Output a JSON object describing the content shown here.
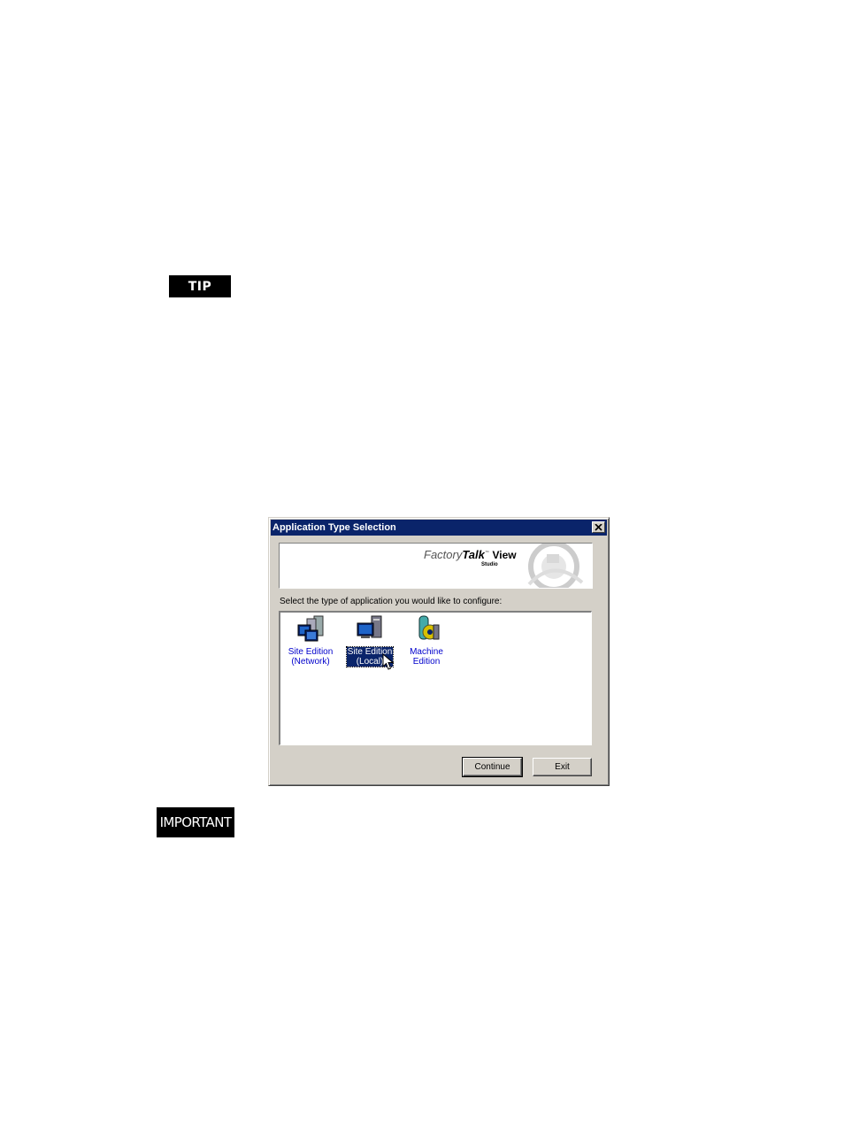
{
  "badges": {
    "tip": "TIP",
    "important": "IMPORTANT"
  },
  "dialog": {
    "title": "Application Type Selection",
    "banner": {
      "brand_prefix": "Factory",
      "brand_bold": "Talk",
      "brand_view": "View",
      "brand_sub": "Studio"
    },
    "instruction": "Select the type of application you would like to configure:",
    "items": [
      {
        "line1": "Site Edition",
        "line2": "(Network)",
        "icon": "network-computers-icon",
        "selected": false
      },
      {
        "line1": "Site Edition",
        "line2": "(Local)",
        "icon": "local-computer-icon",
        "selected": true
      },
      {
        "line1": "Machine",
        "line2": "Edition",
        "icon": "machine-gear-icon",
        "selected": false
      }
    ],
    "buttons": {
      "continue": "Continue",
      "exit": "Exit"
    }
  }
}
